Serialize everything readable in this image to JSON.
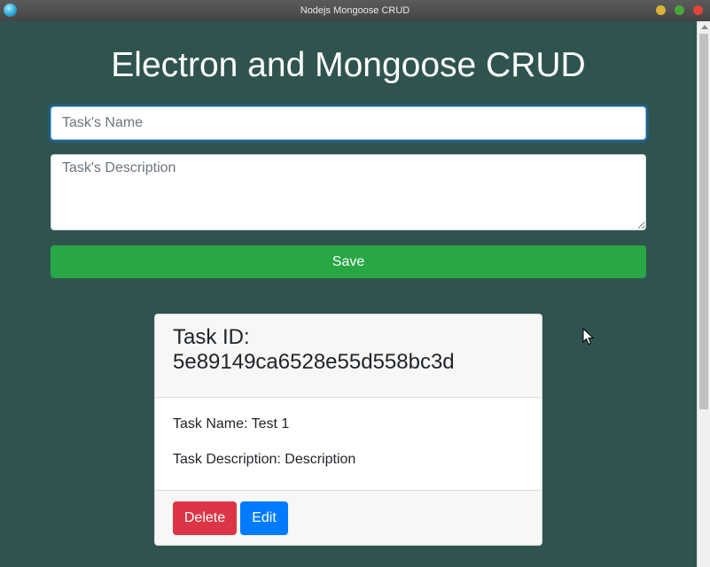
{
  "window": {
    "title": "Nodejs Mongoose CRUD"
  },
  "page": {
    "heading": "Electron and Mongoose CRUD"
  },
  "form": {
    "name_placeholder": "Task's Name",
    "name_value": "",
    "description_placeholder": "Task's Description",
    "description_value": "",
    "save_label": "Save"
  },
  "task": {
    "id_label": "Task ID:",
    "id": "5e89149ca6528e55d558bc3d",
    "name_text": "Task Name: Test 1",
    "description_text": "Task Description: Description",
    "delete_label": "Delete",
    "edit_label": "Edit"
  },
  "colors": {
    "background": "#2f5450",
    "save": "#28a745",
    "delete": "#dc3545",
    "edit": "#007bff"
  }
}
